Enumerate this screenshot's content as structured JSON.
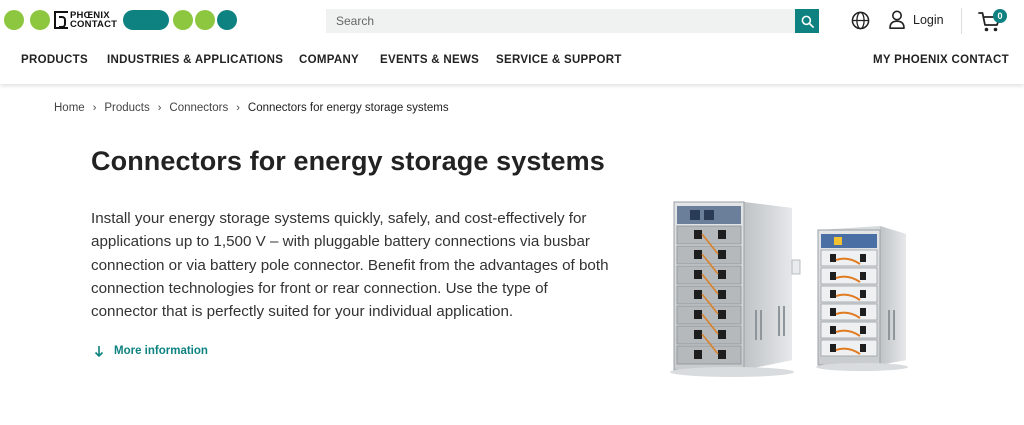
{
  "brand": {
    "logo_text_line1": "PHŒNIX",
    "logo_text_line2": "CONTACT",
    "colors": {
      "green": "#8dc63f",
      "teal": "#0e8281"
    }
  },
  "search": {
    "placeholder": "Search",
    "icon": "search-icon"
  },
  "header": {
    "login_label": "Login",
    "cart_count": "0"
  },
  "nav": {
    "items": [
      {
        "label": "PRODUCTS"
      },
      {
        "label": "INDUSTRIES & APPLICATIONS"
      },
      {
        "label": "COMPANY"
      },
      {
        "label": "EVENTS & NEWS"
      },
      {
        "label": "SERVICE & SUPPORT"
      }
    ],
    "right_item": "MY PHOENIX CONTACT"
  },
  "breadcrumb": [
    "Home",
    "Products",
    "Connectors",
    "Connectors for energy storage systems"
  ],
  "page": {
    "title": "Connectors for energy storage systems",
    "intro": "Install your energy storage systems quickly, safely, and cost-effectively for applications up to 1,500 V – with pluggable battery connections via busbar connection or via battery pole connector. Benefit from the advantages of both connection technologies for front or rear connection. Use the type of connector that is perfectly suited for your individual application.",
    "more_label": "More information"
  }
}
